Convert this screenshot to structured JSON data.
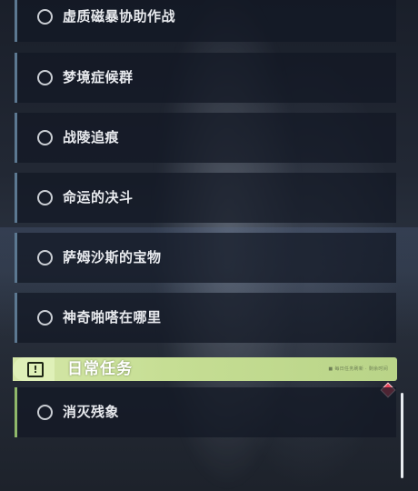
{
  "quests": [
    {
      "label": "虚质磁暴协助作战"
    },
    {
      "label": "梦境症候群"
    },
    {
      "label": "战陵追痕"
    },
    {
      "label": "命运的决斗"
    },
    {
      "label": "萨姆沙斯的宝物"
    },
    {
      "label": "神奇啪嗒在哪里"
    }
  ],
  "daily": {
    "title": "日常任务",
    "tiny_text": "■ 每日任务刷新 · 剩余时间",
    "items": [
      {
        "label": "消灭残象"
      }
    ]
  },
  "colors": {
    "quest_accent": "#5c7891",
    "daily_accent": "#8fb86a",
    "header_green": "#c6de94",
    "marker_red": "#e5455a"
  },
  "icons": {
    "quest_status": "circle-outline-icon",
    "daily_header": "exclamation-box-icon",
    "notification": "diamond-marker-icon"
  }
}
